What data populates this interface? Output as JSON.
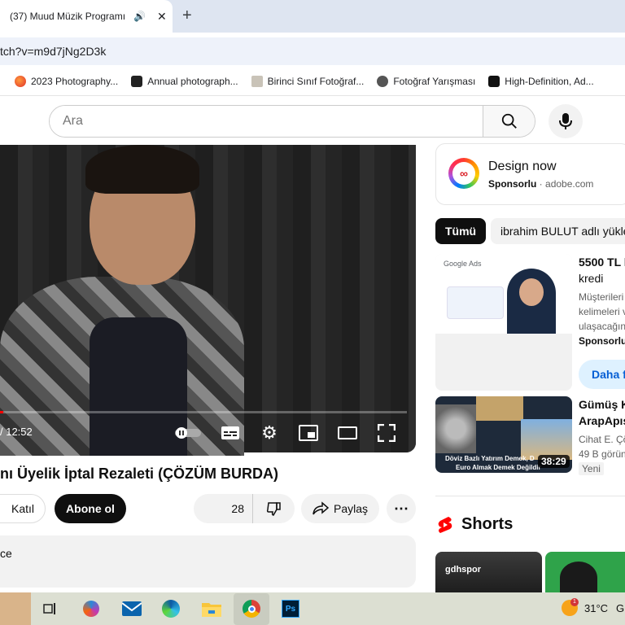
{
  "browser": {
    "tab_title": "(37) Muud Müzik Programı",
    "url": "tch?v=m9d7jNg2D3k",
    "bookmarks": [
      {
        "label": "2023 Photography...",
        "icon": "photography-icon"
      },
      {
        "label": "Annual photograph...",
        "icon": "photograph-award-icon"
      },
      {
        "label": "Birinci Sınıf Fotoğraf...",
        "icon": "camera-icon"
      },
      {
        "label": "Fotoğraf Yarışması",
        "icon": "globe-icon"
      },
      {
        "label": "High-Definition, Ad...",
        "icon": "stock-site-icon"
      }
    ]
  },
  "youtube": {
    "search_placeholder": "Ara",
    "video": {
      "time": "/ 12:52",
      "title": "nı Üyelik İptal Rezaleti (ÇÖZÜM BURDA)"
    },
    "actions": {
      "join": "Katıl",
      "subscribe": "Abone ol",
      "likes": "28",
      "share": "Paylaş"
    },
    "description_snippet": "ce",
    "sidebar": {
      "ad": {
        "title": "Design now",
        "sponsor": "Sponsorlu",
        "domain": "adobe.com"
      },
      "chips": [
        "Tümü",
        "ibrahim BULUT adlı yükle"
      ],
      "items": [
        {
          "thumb_label": "Google Ads",
          "title1": "5500 TL l",
          "title2": "kredi",
          "meta1": "Müşterileri",
          "meta2": "kelimeleri v",
          "meta3": "ulaşacağın",
          "meta4": "Sponsorlu",
          "button": "Daha f"
        },
        {
          "title1": "Gümüş K",
          "title2": "ArapApış",
          "meta1": "Cihat E. Çö",
          "meta2": "49 B görün",
          "badge": "Yeni",
          "duration": "38:29",
          "overlay1": "Döviz Bazlı Yatırım Demek, D",
          "overlay2": "Euro Almak Demek Değildir"
        }
      ],
      "shorts_label": "Shorts",
      "shorts_brand": "gdhspor"
    }
  },
  "taskbar": {
    "temperature": "31°C",
    "extra": "G"
  }
}
